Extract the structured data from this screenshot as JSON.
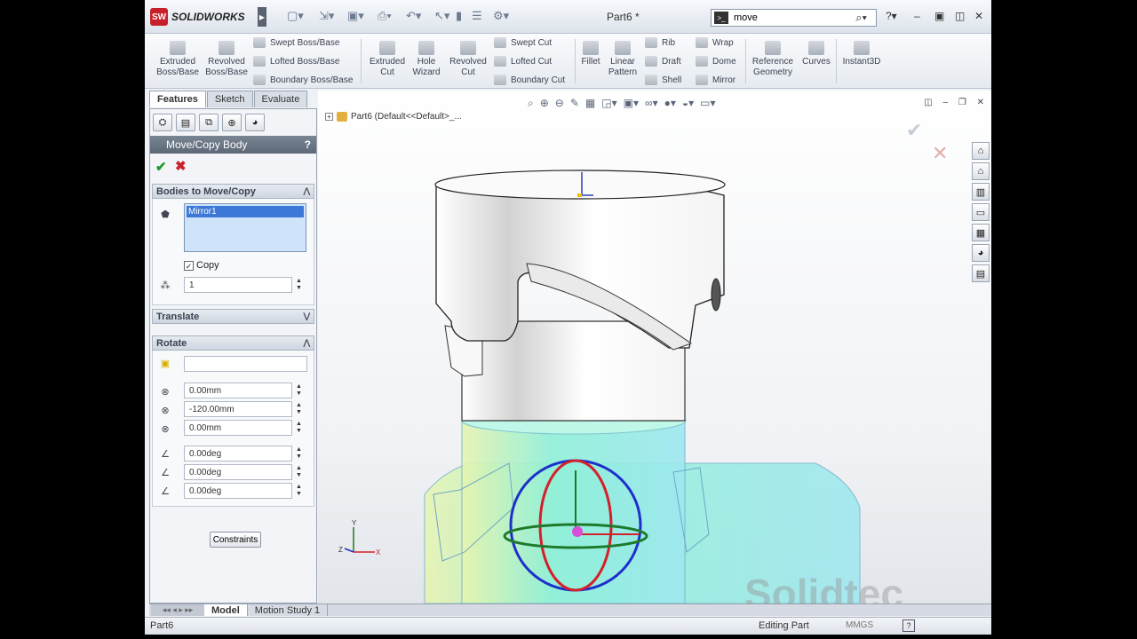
{
  "app": {
    "brand_short": "SW",
    "brand": "SOLIDWORKS",
    "document_title": "Part6 *"
  },
  "search": {
    "value": "move"
  },
  "ribbon": {
    "big": [
      {
        "label1": "Extruded",
        "label2": "Boss/Base"
      },
      {
        "label1": "Revolved",
        "label2": "Boss/Base"
      },
      {
        "label1": "Extruded",
        "label2": "Cut"
      },
      {
        "label1": "Hole",
        "label2": "Wizard"
      },
      {
        "label1": "Revolved",
        "label2": "Cut"
      },
      {
        "label1": "Fillet",
        "label2": ""
      },
      {
        "label1": "Linear",
        "label2": "Pattern"
      },
      {
        "label1": "Reference",
        "label2": "Geometry"
      },
      {
        "label1": "Curves",
        "label2": ""
      },
      {
        "label1": "Instant3D",
        "label2": ""
      }
    ],
    "small": {
      "swept_boss": "Swept Boss/Base",
      "lofted_boss": "Lofted Boss/Base",
      "boundary_boss": "Boundary Boss/Base",
      "swept_cut": "Swept Cut",
      "lofted_cut": "Lofted Cut",
      "boundary_cut": "Boundary Cut",
      "rib": "Rib",
      "draft": "Draft",
      "shell": "Shell",
      "wrap": "Wrap",
      "dome": "Dome",
      "mirror": "Mirror"
    }
  },
  "tabs": {
    "features": "Features",
    "sketch": "Sketch",
    "evaluate": "Evaluate"
  },
  "pm": {
    "title": "Move/Copy Body",
    "help": "?",
    "bodies_group": "Bodies to Move/Copy",
    "selected_body": "Mirror1",
    "copy_label": "Copy",
    "copy_checked": "✓",
    "copies": "1",
    "translate_group": "Translate",
    "rotate_group": "Rotate",
    "rotate_ref": "",
    "x": "0.00mm",
    "y": "-120.00mm",
    "z": "0.00mm",
    "ax": "0.00deg",
    "ay": "0.00deg",
    "az": "0.00deg",
    "constraints": "Constraints"
  },
  "viewport": {
    "tree_label": "Part6  (Default<<Default>_..."
  },
  "watermark": "Solidtec",
  "bottom_tabs": {
    "model": "Model",
    "motion": "Motion Study 1"
  },
  "status": {
    "part": "Part6",
    "mode": "Editing Part",
    "units": "MMGS",
    "help": "?"
  },
  "colors": {
    "accent_red": "#c8202a",
    "ok_green": "#1d9a2a",
    "selection_blue": "#3c78d8",
    "body_cyan": "#8ff0d8"
  }
}
